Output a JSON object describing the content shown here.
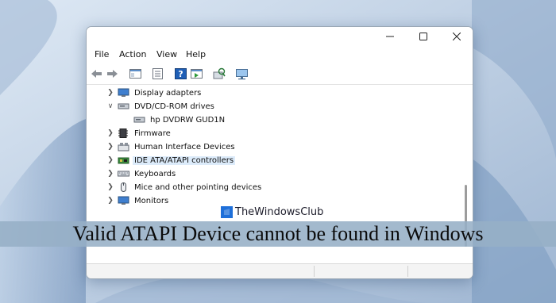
{
  "window": {
    "minimize_icon": "minimize-icon",
    "maximize_icon": "maximize-icon",
    "close_icon": "close-icon"
  },
  "menu": {
    "items": [
      "File",
      "Action",
      "View",
      "Help"
    ]
  },
  "toolbar": {
    "icons": [
      "back-arrow-icon",
      "forward-arrow-icon",
      "show-hide-tree-icon",
      "properties-icon",
      "help-icon",
      "action-pane-icon",
      "scan-hardware-icon",
      "monitor-icon"
    ]
  },
  "tree": {
    "items": [
      {
        "label": "Display adapters",
        "state": "collapsed",
        "icon": "display-adapter-icon"
      },
      {
        "label": "DVD/CD-ROM drives",
        "state": "expanded",
        "icon": "dvd-drive-icon"
      },
      {
        "label": "hp DVDRW GUD1N",
        "state": "child",
        "icon": "dvd-device-icon"
      },
      {
        "label": "Firmware",
        "state": "collapsed",
        "icon": "firmware-icon"
      },
      {
        "label": "Human Interface Devices",
        "state": "collapsed",
        "icon": "hid-icon"
      },
      {
        "label": "IDE ATA/ATAPI controllers",
        "state": "collapsed",
        "icon": "ide-controller-icon",
        "selected": true
      },
      {
        "label": "Keyboards",
        "state": "collapsed",
        "icon": "keyboard-icon"
      },
      {
        "label": "Mice and other pointing devices",
        "state": "collapsed",
        "icon": "mouse-icon"
      },
      {
        "label": "Monitors",
        "state": "collapsed",
        "icon": "monitor-device-icon"
      }
    ]
  },
  "watermark": {
    "text": "TheWindowsClub",
    "icon": "windows-logo-icon"
  },
  "banner": {
    "text": "Valid ATAPI Device cannot be found in Windows"
  },
  "colors": {
    "selection": "#dcebfa",
    "banner": "#96afc6",
    "accent": "#1e6fd9"
  }
}
